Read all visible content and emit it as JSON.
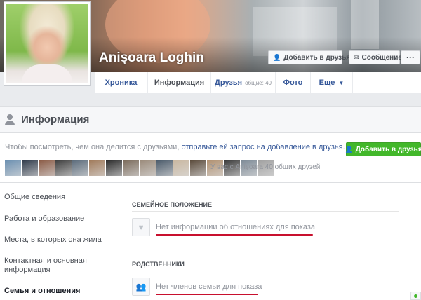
{
  "profile": {
    "name": "Anişoara Loghin"
  },
  "cover_actions": {
    "add_friend": "Добавить в друзья",
    "message": "Сообщение",
    "more": "···"
  },
  "nav": {
    "tabs": [
      {
        "label": "Хроника"
      },
      {
        "label": "Информация"
      },
      {
        "label": "Друзья",
        "sub": "общие: 40"
      },
      {
        "label": "Фото"
      },
      {
        "label": "Еще"
      }
    ]
  },
  "info": {
    "title": "Информация",
    "notice_prefix": "Чтобы посмотреть, чем она делится с друзьями, ",
    "notice_link": "отправьте ей запрос на добавление в друзья",
    "notice_suffix": ".",
    "add_friend_button": "Добавить в друзья",
    "mutual_friends": "У вас с Anişoara 40 общих друзей",
    "friend_thumb_colors": [
      "#6b8fb0",
      "#2f3a4a",
      "#8a5a44",
      "#3d3d3d",
      "#5b6b7b",
      "#a07a5a",
      "#2a2a2a",
      "#7a6a5a",
      "#9a8a7a",
      "#4a5a6a",
      "#c9b7a0",
      "#5a4a3a",
      "#b09070",
      "#3a3a3a",
      "#7d8a96",
      "#a0a0a0"
    ]
  },
  "sidebar": {
    "items": [
      {
        "label": "Общие сведения"
      },
      {
        "label": "Работа и образование"
      },
      {
        "label": "Места, в которых она жила"
      },
      {
        "label": "Контактная и основная информация"
      },
      {
        "label": "Семья и отношения"
      }
    ]
  },
  "sections": {
    "family_status": {
      "title": "СЕМЕЙНОЕ ПОЛОЖЕНИЕ",
      "text": "Нет информации об отношениях для показа"
    },
    "relatives": {
      "title": "РОДСТВЕННИКИ",
      "text": "Нет членов семьи для показа"
    }
  },
  "colors": {
    "link": "#365899",
    "green": "#42b72a",
    "annotation_red": "#c8102e"
  }
}
